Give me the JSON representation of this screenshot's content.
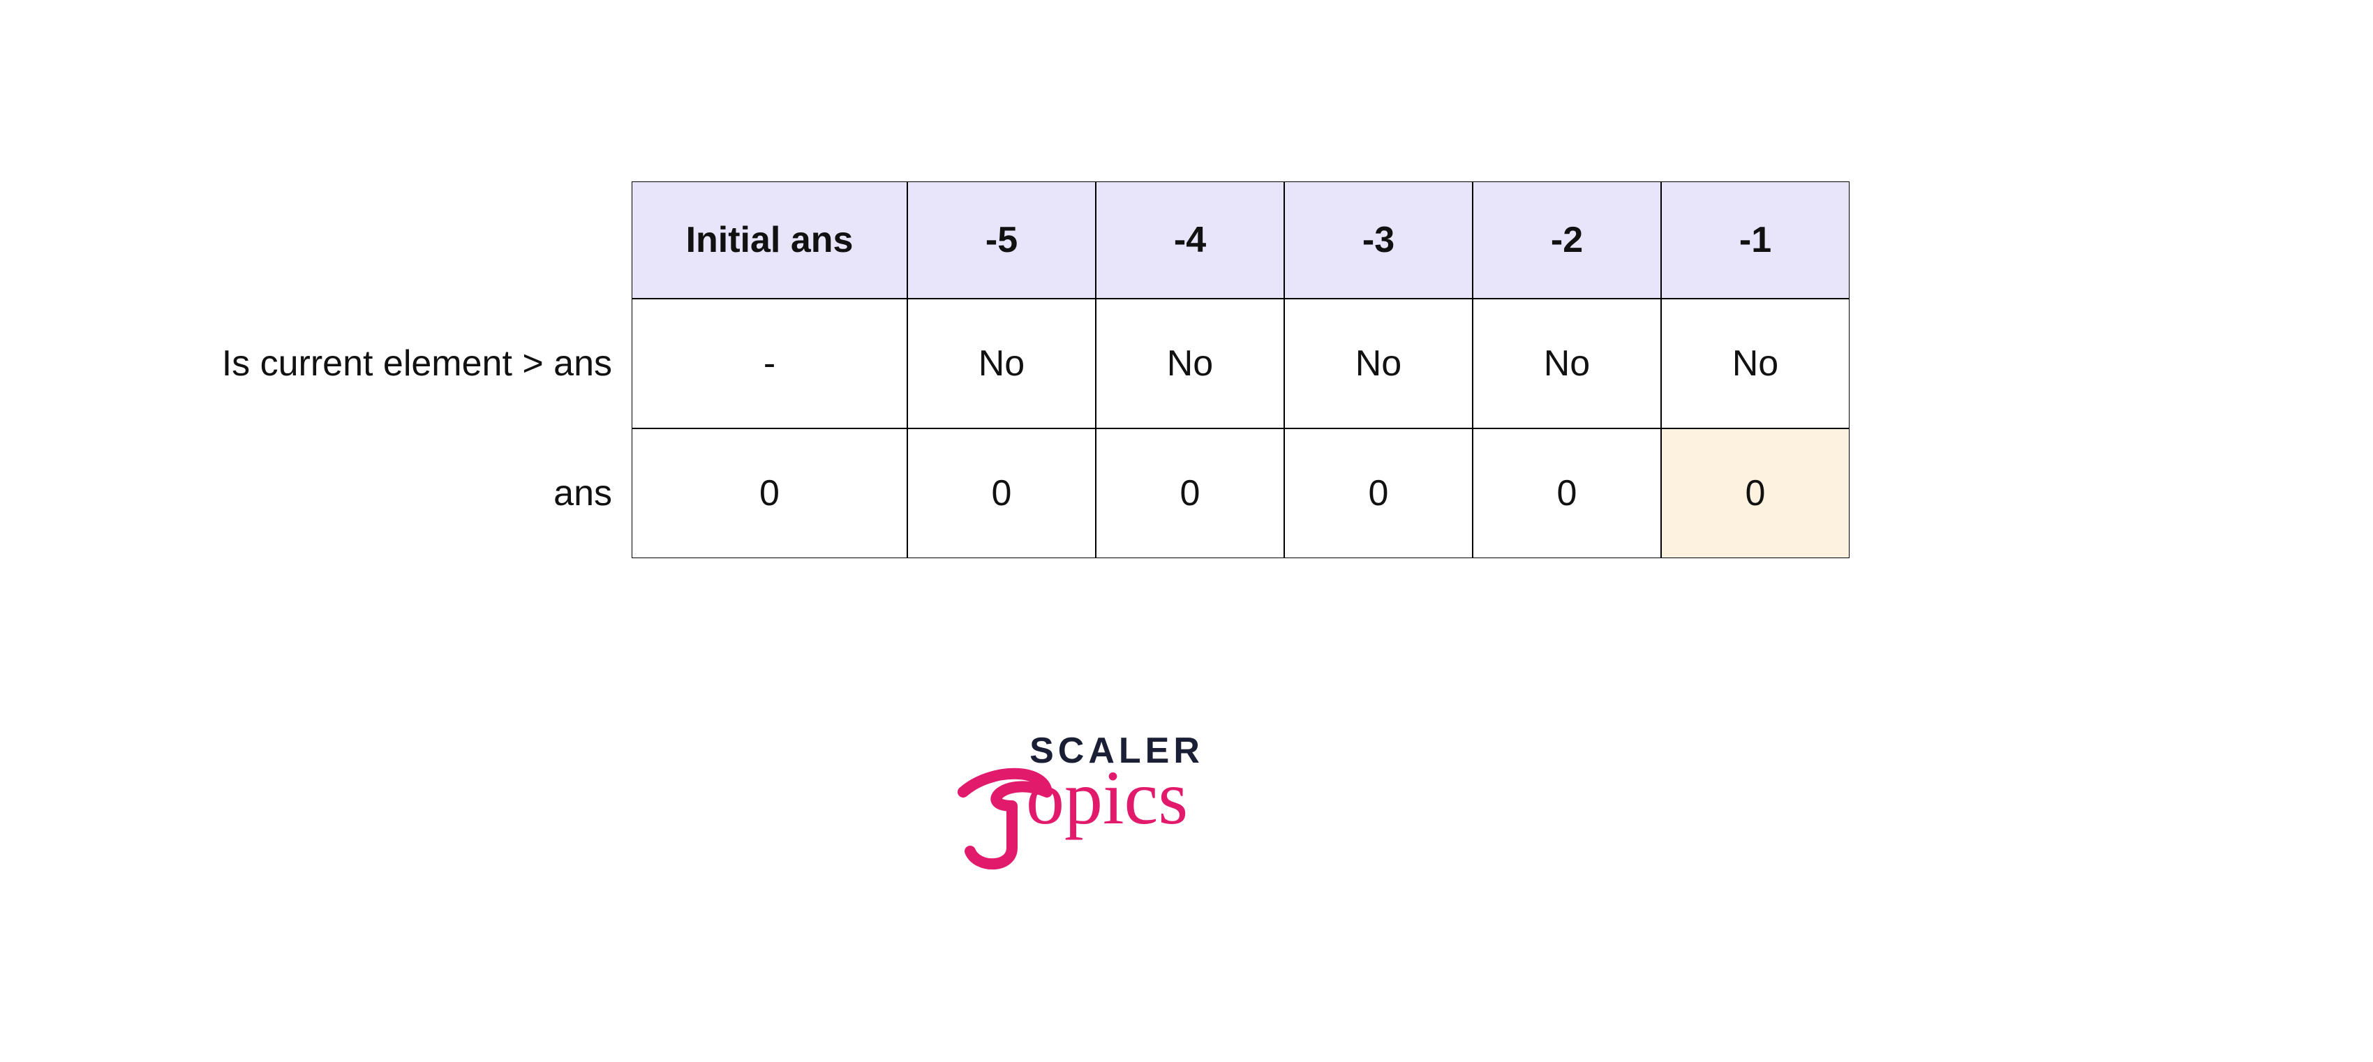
{
  "chart_data": {
    "type": "table",
    "columns": [
      "Initial ans",
      "-5",
      "-4",
      "-3",
      "-2",
      "-1"
    ],
    "rows": [
      {
        "label": "Is current element > ans",
        "values": [
          "-",
          "No",
          "No",
          "No",
          "No",
          "No"
        ]
      },
      {
        "label": "ans",
        "values": [
          "0",
          "0",
          "0",
          "0",
          "0",
          "0"
        ],
        "highlightIndex": 5
      }
    ]
  },
  "logo": {
    "line1": "SCALER",
    "line2": "Topics"
  }
}
